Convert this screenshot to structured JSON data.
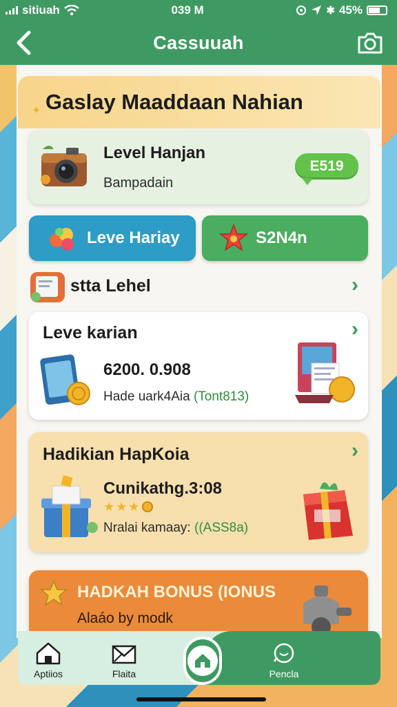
{
  "status_bar": {
    "carrier": "sitiuah",
    "time": "039 M",
    "battery": "45%"
  },
  "nav": {
    "title": "Cassuuah"
  },
  "headline": "Gaslay Maaddaan Nahian",
  "level_card": {
    "title": "Level Hanjan",
    "subtitle": "Bampadain",
    "badge": "E519"
  },
  "pills": {
    "left_label": "Leve Hariay",
    "right_label": "S2N4n"
  },
  "row_link": {
    "label": "stta Lehel"
  },
  "leve_card": {
    "title": "Leve karian",
    "value": "6200. 0.908",
    "note_prefix": "Hade uark4Aia ",
    "note_highlight": "(Tont813)"
  },
  "hadik_card": {
    "title": "Hadikian HapKoia",
    "value": "Cunikathg.3:08",
    "rating": 3,
    "note_prefix": "Nralai kamaay: ",
    "note_highlight": "((ASS8a)"
  },
  "bonus_card": {
    "title": "HADKAH BONUS (IONUS",
    "subtitle": "Alaáo by modk"
  },
  "tabs": {
    "tab1": "Aptiios",
    "tab2": "Flaita",
    "tab4": "Pencla"
  },
  "colors": {
    "primary_green": "#3e9a62",
    "blue_pill": "#2d9cc6",
    "orange_bonus": "#eb8a3a"
  }
}
